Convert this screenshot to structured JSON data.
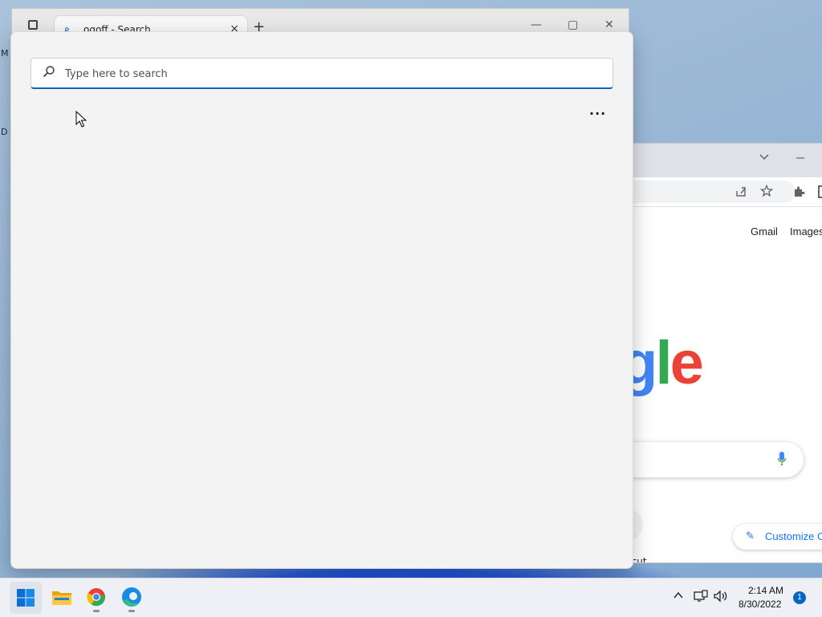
{
  "desktop": {
    "fragment_top": "M",
    "fragment_bottom": "D"
  },
  "edge_window": {
    "tab_title": "ogoff - Search",
    "tab_close": "×",
    "new_tab": "+",
    "minimize": "—",
    "restore": "▢",
    "close": "✕"
  },
  "chrome_window": {
    "links": {
      "gmail": "Gmail",
      "images": "Images"
    },
    "logo": {
      "g": "g",
      "l": "l",
      "e": "e"
    },
    "shortcut_label": "rtcut",
    "customize_label": "Customize C",
    "icons": [
      "chevron-down-icon",
      "minimize-icon",
      "share-icon",
      "star-icon",
      "extension-icon",
      "sidepanel-icon",
      "mic-icon",
      "pencil-icon"
    ]
  },
  "search_panel": {
    "search_placeholder": "Type here to search",
    "more_options": "···"
  },
  "taskbar": {
    "apps": [
      "start-icon",
      "file-explorer-icon",
      "chrome-icon",
      "edge-icon"
    ],
    "clock_time": "2:14 AM",
    "clock_date": "8/30/2022",
    "notification_count": "1"
  },
  "colors": {
    "accent": "#0067c0",
    "google_blue": "#4285f4",
    "google_green": "#34a853",
    "google_red": "#ea4335",
    "chrome_link": "#1a73e8"
  }
}
